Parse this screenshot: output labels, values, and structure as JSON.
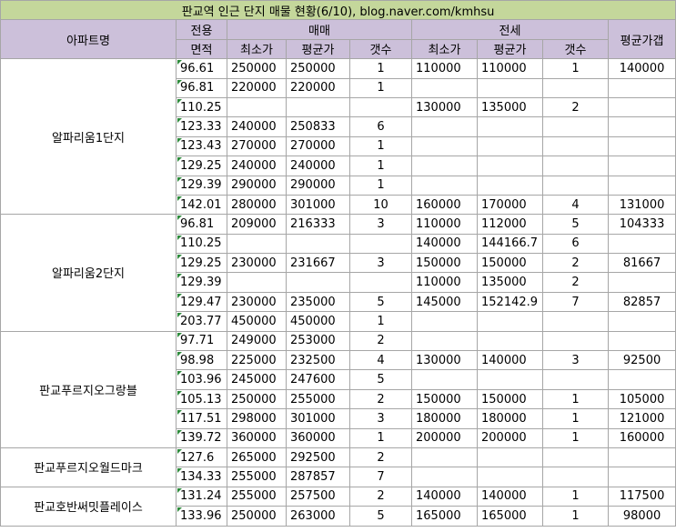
{
  "title": "판교역 인근 단지 매물 현황(6/10), blog.naver.com/kmhsu",
  "headers": {
    "apt_name": "아파트명",
    "area_top": "전용",
    "area_bottom": "면적",
    "sale": "매매",
    "jeonse": "전세",
    "min_price": "최소가",
    "avg_price": "평균가",
    "count": "갯수",
    "gap": "평균가갭"
  },
  "complexes": [
    {
      "name": "알파리움1단지",
      "rows": [
        {
          "area": "96.61",
          "sale_min": "250000",
          "sale_avg": "250000",
          "sale_cnt": "1",
          "j_min": "110000",
          "j_avg": "110000",
          "j_cnt": "1",
          "gap": "140000"
        },
        {
          "area": "96.81",
          "sale_min": "220000",
          "sale_avg": "220000",
          "sale_cnt": "1",
          "j_min": "",
          "j_avg": "",
          "j_cnt": "",
          "gap": ""
        },
        {
          "area": "110.25",
          "sale_min": "",
          "sale_avg": "",
          "sale_cnt": "",
          "j_min": "130000",
          "j_avg": "135000",
          "j_cnt": "2",
          "gap": ""
        },
        {
          "area": "123.33",
          "sale_min": "240000",
          "sale_avg": "250833",
          "sale_cnt": "6",
          "j_min": "",
          "j_avg": "",
          "j_cnt": "",
          "gap": ""
        },
        {
          "area": "123.43",
          "sale_min": "270000",
          "sale_avg": "270000",
          "sale_cnt": "1",
          "j_min": "",
          "j_avg": "",
          "j_cnt": "",
          "gap": ""
        },
        {
          "area": "129.25",
          "sale_min": "240000",
          "sale_avg": "240000",
          "sale_cnt": "1",
          "j_min": "",
          "j_avg": "",
          "j_cnt": "",
          "gap": ""
        },
        {
          "area": "129.39",
          "sale_min": "290000",
          "sale_avg": "290000",
          "sale_cnt": "1",
          "j_min": "",
          "j_avg": "",
          "j_cnt": "",
          "gap": ""
        },
        {
          "area": "142.01",
          "sale_min": "280000",
          "sale_avg": "301000",
          "sale_cnt": "10",
          "j_min": "160000",
          "j_avg": "170000",
          "j_cnt": "4",
          "gap": "131000"
        }
      ]
    },
    {
      "name": "알파리움2단지",
      "rows": [
        {
          "area": "96.81",
          "sale_min": "209000",
          "sale_avg": "216333",
          "sale_cnt": "3",
          "j_min": "110000",
          "j_avg": "112000",
          "j_cnt": "5",
          "gap": "104333"
        },
        {
          "area": "110.25",
          "sale_min": "",
          "sale_avg": "",
          "sale_cnt": "",
          "j_min": "140000",
          "j_avg": "144166.7",
          "j_cnt": "6",
          "gap": ""
        },
        {
          "area": "129.25",
          "sale_min": "230000",
          "sale_avg": "231667",
          "sale_cnt": "3",
          "j_min": "150000",
          "j_avg": "150000",
          "j_cnt": "2",
          "gap": "81667"
        },
        {
          "area": "129.39",
          "sale_min": "",
          "sale_avg": "",
          "sale_cnt": "",
          "j_min": "110000",
          "j_avg": "135000",
          "j_cnt": "2",
          "gap": ""
        },
        {
          "area": "129.47",
          "sale_min": "230000",
          "sale_avg": "235000",
          "sale_cnt": "5",
          "j_min": "145000",
          "j_avg": "152142.9",
          "j_cnt": "7",
          "gap": "82857"
        },
        {
          "area": "203.77",
          "sale_min": "450000",
          "sale_avg": "450000",
          "sale_cnt": "1",
          "j_min": "",
          "j_avg": "",
          "j_cnt": "",
          "gap": ""
        }
      ]
    },
    {
      "name": "판교푸르지오그랑블",
      "rows": [
        {
          "area": "97.71",
          "sale_min": "249000",
          "sale_avg": "253000",
          "sale_cnt": "2",
          "j_min": "",
          "j_avg": "",
          "j_cnt": "",
          "gap": ""
        },
        {
          "area": "98.98",
          "sale_min": "225000",
          "sale_avg": "232500",
          "sale_cnt": "4",
          "j_min": "130000",
          "j_avg": "140000",
          "j_cnt": "3",
          "gap": "92500"
        },
        {
          "area": "103.96",
          "sale_min": "245000",
          "sale_avg": "247600",
          "sale_cnt": "5",
          "j_min": "",
          "j_avg": "",
          "j_cnt": "",
          "gap": ""
        },
        {
          "area": "105.13",
          "sale_min": "250000",
          "sale_avg": "255000",
          "sale_cnt": "2",
          "j_min": "150000",
          "j_avg": "150000",
          "j_cnt": "1",
          "gap": "105000"
        },
        {
          "area": "117.51",
          "sale_min": "298000",
          "sale_avg": "301000",
          "sale_cnt": "3",
          "j_min": "180000",
          "j_avg": "180000",
          "j_cnt": "1",
          "gap": "121000"
        },
        {
          "area": "139.72",
          "sale_min": "360000",
          "sale_avg": "360000",
          "sale_cnt": "1",
          "j_min": "200000",
          "j_avg": "200000",
          "j_cnt": "1",
          "gap": "160000"
        }
      ]
    },
    {
      "name": "판교푸르지오월드마크",
      "rows": [
        {
          "area": "127.6",
          "sale_min": "265000",
          "sale_avg": "292500",
          "sale_cnt": "2",
          "j_min": "",
          "j_avg": "",
          "j_cnt": "",
          "gap": ""
        },
        {
          "area": "134.33",
          "sale_min": "255000",
          "sale_avg": "287857",
          "sale_cnt": "7",
          "j_min": "",
          "j_avg": "",
          "j_cnt": "",
          "gap": ""
        }
      ]
    },
    {
      "name": "판교호반써밋플레이스",
      "rows": [
        {
          "area": "131.24",
          "sale_min": "255000",
          "sale_avg": "257500",
          "sale_cnt": "2",
          "j_min": "140000",
          "j_avg": "140000",
          "j_cnt": "1",
          "gap": "117500"
        },
        {
          "area": "133.96",
          "sale_min": "250000",
          "sale_avg": "263000",
          "sale_cnt": "5",
          "j_min": "165000",
          "j_avg": "165000",
          "j_cnt": "1",
          "gap": "98000"
        }
      ]
    }
  ]
}
